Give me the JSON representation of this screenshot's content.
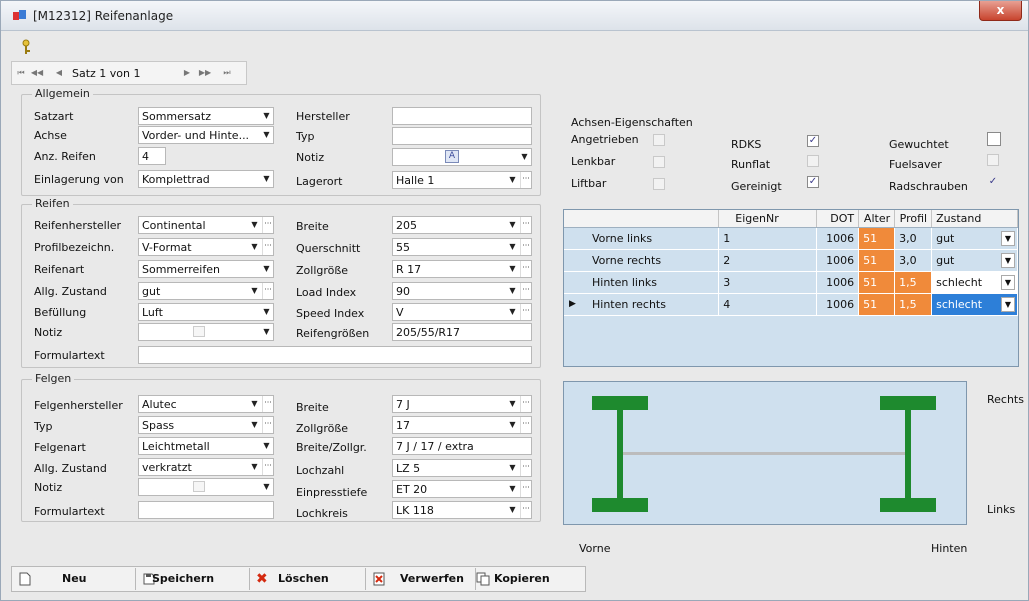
{
  "window": {
    "title": "[M12312] Reifenanlage",
    "close": "x"
  },
  "nav": {
    "text": "Satz 1 von 1"
  },
  "allgemein": {
    "legend": "Allgemein",
    "satzart_label": "Satzart",
    "satzart_value": "Sommersatz",
    "achse_label": "Achse",
    "achse_value": "Vorder- und Hinte...",
    "anz_label": "Anz. Reifen",
    "anz_value": "4",
    "einlagerung_label": "Einlagerung von",
    "einlagerung_value": "Komplettrad",
    "hersteller_label": "Hersteller",
    "hersteller_value": "",
    "typ_label": "Typ",
    "typ_value": "",
    "notiz_label": "Notiz",
    "lagerort_label": "Lagerort",
    "lagerort_value": "Halle 1"
  },
  "achsen": {
    "title": "Achsen-Eigenschaften",
    "items": [
      {
        "label": "Angetrieben",
        "checked": false
      },
      {
        "label": "Lenkbar",
        "checked": false
      },
      {
        "label": "Liftbar",
        "checked": false
      },
      {
        "label": "RDKS",
        "checked": true
      },
      {
        "label": "Runflat",
        "checked": false
      },
      {
        "label": "Gereinigt",
        "checked": true
      },
      {
        "label": "Gewuchtet",
        "checked": false
      },
      {
        "label": "Fuelsaver",
        "checked": false
      },
      {
        "label": "Radschrauben",
        "checked": true
      }
    ]
  },
  "reifen": {
    "legend": "Reifen",
    "hersteller_label": "Reifenhersteller",
    "hersteller_value": "Continental",
    "profil_label": "Profilbezeichn.",
    "profil_value": "V-Format",
    "art_label": "Reifenart",
    "art_value": "Sommerreifen",
    "zustand_label": "Allg. Zustand",
    "zustand_value": "gut",
    "befuellung_label": "Befüllung",
    "befuellung_value": "Luft",
    "notiz_label": "Notiz",
    "formular_label": "Formulartext",
    "breite_label": "Breite",
    "breite_value": "205",
    "querschnitt_label": "Querschnitt",
    "querschnitt_value": "55",
    "zoll_label": "Zollgröße",
    "zoll_value": "R 17",
    "load_label": "Load Index",
    "load_value": "90",
    "speed_label": "Speed Index",
    "speed_value": "V",
    "groessen_label": "Reifengrößen",
    "groessen_value": "205/55/R17"
  },
  "grid": {
    "columns": [
      "",
      "EigenNr",
      "DOT",
      "Alter",
      "Profil",
      "Zustand"
    ],
    "rows": [
      {
        "pos": "Vorne links",
        "nr": "1",
        "dot": "1006",
        "alter": "51",
        "profil": "3,0",
        "zustand": "gut"
      },
      {
        "pos": "Vorne rechts",
        "nr": "2",
        "dot": "1006",
        "alter": "51",
        "profil": "3,0",
        "zustand": "gut"
      },
      {
        "pos": "Hinten links",
        "nr": "3",
        "dot": "1006",
        "alter": "51",
        "profil": "1,5",
        "zustand": "schlecht"
      },
      {
        "pos": "Hinten rechts",
        "nr": "4",
        "dot": "1006",
        "alter": "51",
        "profil": "1,5",
        "zustand": "schlecht"
      }
    ]
  },
  "felgen": {
    "legend": "Felgen",
    "hersteller_label": "Felgenhersteller",
    "hersteller_value": "Alutec",
    "typ_label": "Typ",
    "typ_value": "Spass",
    "art_label": "Felgenart",
    "art_value": "Leichtmetall",
    "zustand_label": "Allg. Zustand",
    "zustand_value": "verkratzt",
    "notiz_label": "Notiz",
    "formular_label": "Formulartext",
    "breite_label": "Breite",
    "breite_value": "7 J",
    "zoll_label": "Zollgröße",
    "zoll_value": "17",
    "bz_label": "Breite/Zollgr.",
    "bz_value": "7 J / 17 / extra",
    "lochzahl_label": "Lochzahl",
    "lochzahl_value": "LZ 5",
    "einpress_label": "Einpresstiefe",
    "einpress_value": "ET 20",
    "lochkreis_label": "Lochkreis",
    "lochkreis_value": "LK 118"
  },
  "diagram": {
    "rechts": "Rechts",
    "links": "Links",
    "vorne": "Vorne",
    "hinten": "Hinten"
  },
  "buttons": {
    "neu": "Neu",
    "speichern": "Speichern",
    "loeschen": "Löschen",
    "verwerfen": "Verwerfen",
    "kopieren": "Kopieren"
  },
  "colors": {
    "highlight": "#f08a3a",
    "selection": "#2d7fd8",
    "axle": "#1e8a2e",
    "grid_bg": "#cfe0ee"
  }
}
